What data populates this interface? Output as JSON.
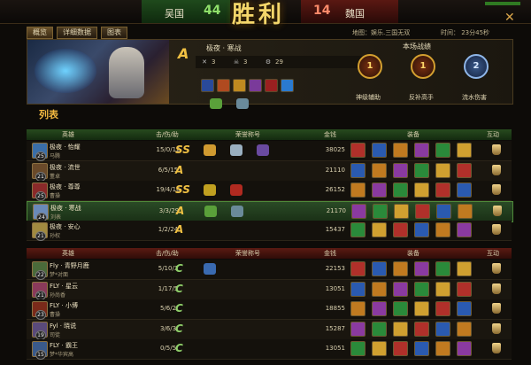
{
  "header": {
    "left_team": "吴国",
    "left_score": "44",
    "result": "胜利",
    "right_score": "14",
    "right_team": "魏国"
  },
  "tabs": [
    "概览",
    "详细数据",
    "图表"
  ],
  "map": "地图：娱乐.三国无双",
  "time": "时间： 23分45秒",
  "hero_panel": {
    "rank": "A",
    "hero_name": "极夜 · 寒战",
    "kills": "3",
    "deaths": "3",
    "assists": "29"
  },
  "battle": {
    "title": "本场战绩",
    "badges": [
      {
        "num": "1",
        "label": "神级辅助",
        "color": "gold"
      },
      {
        "num": "1",
        "label": "反补高手",
        "color": "gold"
      },
      {
        "num": "2",
        "label": "流水伤害",
        "color": "blue"
      }
    ]
  },
  "list_title": "列表",
  "columns": {
    "hero": "英雄",
    "kda": "击/伤/助",
    "honor": "荣誉称号",
    "gold": "金钱",
    "equip": "装备",
    "interact": "互动"
  },
  "team1": [
    {
      "name": "极夜 · 怡耀",
      "hero": "马腾",
      "level": "25",
      "kda": "15/0/12",
      "rank": "SS",
      "gold": "38025",
      "color": "#3a6ea8"
    },
    {
      "name": "极夜 · 流世",
      "hero": "董卓",
      "level": "21",
      "kda": "6/5/15",
      "rank": "A",
      "gold": "21110",
      "color": "#6a4a2a"
    },
    {
      "name": "极夜 · 尊尊",
      "hero": "曹操",
      "level": "25",
      "kda": "19/4/16",
      "rank": "SS",
      "gold": "26152",
      "color": "#8a2a2a"
    },
    {
      "name": "极夜 · 寒战",
      "hero": "刘表",
      "level": "24",
      "kda": "3/3/29",
      "rank": "A",
      "gold": "21170",
      "color": "#6a8ab8"
    },
    {
      "name": "极夜 · 安心",
      "hero": "孙权",
      "level": "21",
      "kda": "1/2/24",
      "rank": "A",
      "gold": "15437",
      "color": "#a08a40"
    }
  ],
  "team2": [
    {
      "name": "Fly · 青野月鹿",
      "hero": "梦*对面",
      "level": "22",
      "kda": "5/10/3",
      "rank": "C",
      "gold": "22153",
      "color": "#4a6a3a"
    },
    {
      "name": "FLY · 星云",
      "hero": "孙尚香",
      "level": "21",
      "kda": "1/17/5",
      "rank": "C",
      "gold": "13051",
      "color": "#8a3a5a"
    },
    {
      "name": "FLY · 小博",
      "hero": "曹操",
      "level": "23",
      "kda": "5/6/2",
      "rank": "C",
      "gold": "18855",
      "color": "#7a2a1a"
    },
    {
      "name": "Fyl · 晓说",
      "hero": "司徒",
      "level": "19",
      "kda": "3/6/3",
      "rank": "C",
      "gold": "15287",
      "color": "#5a4a7a"
    },
    {
      "name": "FLY · 霸王",
      "hero": "梦*华宾高",
      "level": "15",
      "kda": "0/5/5",
      "rank": "C",
      "gold": "13051",
      "color": "#3a5a8a"
    }
  ]
}
